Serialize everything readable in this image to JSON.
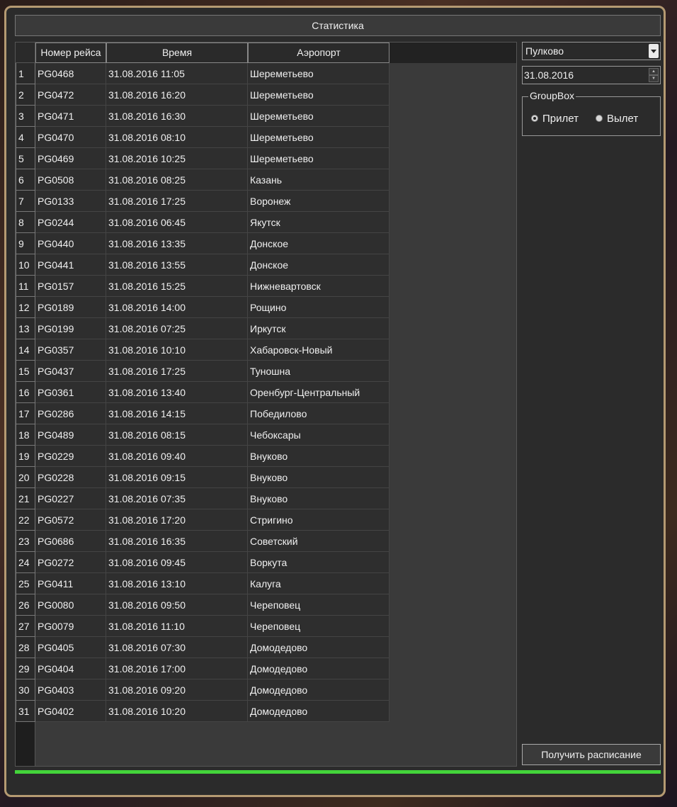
{
  "window": {
    "title_button": "Статистика"
  },
  "table": {
    "columns": [
      "Номер рейса",
      "Время",
      "Аэропорт"
    ],
    "rows": [
      {
        "n": "1",
        "flight": "PG0468",
        "time": "31.08.2016 11:05",
        "airport": "Шереметьево"
      },
      {
        "n": "2",
        "flight": "PG0472",
        "time": "31.08.2016 16:20",
        "airport": "Шереметьево"
      },
      {
        "n": "3",
        "flight": "PG0471",
        "time": "31.08.2016 16:30",
        "airport": "Шереметьево"
      },
      {
        "n": "4",
        "flight": "PG0470",
        "time": "31.08.2016 08:10",
        "airport": "Шереметьево"
      },
      {
        "n": "5",
        "flight": "PG0469",
        "time": "31.08.2016 10:25",
        "airport": "Шереметьево"
      },
      {
        "n": "6",
        "flight": "PG0508",
        "time": "31.08.2016 08:25",
        "airport": "Казань"
      },
      {
        "n": "7",
        "flight": "PG0133",
        "time": "31.08.2016 17:25",
        "airport": "Воронеж"
      },
      {
        "n": "8",
        "flight": "PG0244",
        "time": "31.08.2016 06:45",
        "airport": "Якутск"
      },
      {
        "n": "9",
        "flight": "PG0440",
        "time": "31.08.2016 13:35",
        "airport": "Донское"
      },
      {
        "n": "10",
        "flight": "PG0441",
        "time": "31.08.2016 13:55",
        "airport": "Донское"
      },
      {
        "n": "11",
        "flight": "PG0157",
        "time": "31.08.2016 15:25",
        "airport": "Нижневартовск"
      },
      {
        "n": "12",
        "flight": "PG0189",
        "time": "31.08.2016 14:00",
        "airport": "Рощино"
      },
      {
        "n": "13",
        "flight": "PG0199",
        "time": "31.08.2016 07:25",
        "airport": "Иркутск"
      },
      {
        "n": "14",
        "flight": "PG0357",
        "time": "31.08.2016 10:10",
        "airport": "Хабаровск-Новый"
      },
      {
        "n": "15",
        "flight": "PG0437",
        "time": "31.08.2016 17:25",
        "airport": "Туношна"
      },
      {
        "n": "16",
        "flight": "PG0361",
        "time": "31.08.2016 13:40",
        "airport": "Оренбург-Центральный"
      },
      {
        "n": "17",
        "flight": "PG0286",
        "time": "31.08.2016 14:15",
        "airport": "Победилово"
      },
      {
        "n": "18",
        "flight": "PG0489",
        "time": "31.08.2016 08:15",
        "airport": "Чебоксары"
      },
      {
        "n": "19",
        "flight": "PG0229",
        "time": "31.08.2016 09:40",
        "airport": "Внуково"
      },
      {
        "n": "20",
        "flight": "PG0228",
        "time": "31.08.2016 09:15",
        "airport": "Внуково"
      },
      {
        "n": "21",
        "flight": "PG0227",
        "time": "31.08.2016 07:35",
        "airport": "Внуково"
      },
      {
        "n": "22",
        "flight": "PG0572",
        "time": "31.08.2016 17:20",
        "airport": "Стригино"
      },
      {
        "n": "23",
        "flight": "PG0686",
        "time": "31.08.2016 16:35",
        "airport": "Советский"
      },
      {
        "n": "24",
        "flight": "PG0272",
        "time": "31.08.2016 09:45",
        "airport": "Воркута"
      },
      {
        "n": "25",
        "flight": "PG0411",
        "time": "31.08.2016 13:10",
        "airport": "Калуга"
      },
      {
        "n": "26",
        "flight": "PG0080",
        "time": "31.08.2016 09:50",
        "airport": "Череповец"
      },
      {
        "n": "27",
        "flight": "PG0079",
        "time": "31.08.2016 11:10",
        "airport": "Череповец"
      },
      {
        "n": "28",
        "flight": "PG0405",
        "time": "31.08.2016 07:30",
        "airport": "Домодедово"
      },
      {
        "n": "29",
        "flight": "PG0404",
        "time": "31.08.2016 17:00",
        "airport": "Домодедово"
      },
      {
        "n": "30",
        "flight": "PG0403",
        "time": "31.08.2016 09:20",
        "airport": "Домодедово"
      },
      {
        "n": "31",
        "flight": "PG0402",
        "time": "31.08.2016 10:20",
        "airport": "Домодедово"
      }
    ]
  },
  "sidebar": {
    "airport_combo": {
      "value": "Пулково"
    },
    "date_edit": {
      "value": "31.08.2016"
    },
    "groupbox": {
      "title": "GroupBox",
      "arrival_label": "Прилет",
      "departure_label": "Вылет",
      "selected": "arrival"
    },
    "get_schedule_button": "Получить расписание"
  },
  "progress": {
    "value_percent": 100,
    "color": "#43d33a"
  },
  "icons": {
    "combo_arrow": "chevron-down-icon",
    "spin_up": "spin-up-icon",
    "spin_down": "spin-down-icon"
  }
}
